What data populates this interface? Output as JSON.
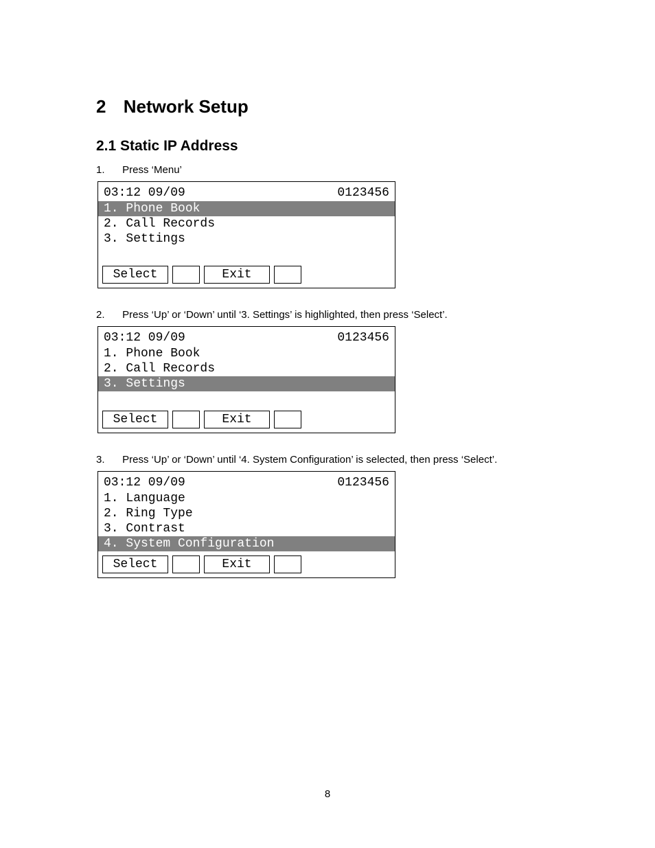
{
  "chapter": {
    "number": "2",
    "title": "Network Setup"
  },
  "section": {
    "number": "2.1",
    "title": "Static IP Address"
  },
  "steps": [
    {
      "n": "1.",
      "text": "Press ‘Menu’"
    },
    {
      "n": "2.",
      "text": "Press ‘Up’ or ‘Down’ until ‘3. Settings’ is highlighted, then press ‘Select’."
    },
    {
      "n": "3.",
      "text": "Press ‘Up’ or ‘Down’ until ‘4. System Configuration’ is selected, then press ‘Select’."
    }
  ],
  "screens": [
    {
      "time": "03:12 09/09",
      "num": "0123456",
      "items": [
        {
          "label": "1. Phone Book",
          "hi": true
        },
        {
          "label": "2. Call Records",
          "hi": false
        },
        {
          "label": "3. Settings",
          "hi": false
        }
      ],
      "spacer": true,
      "softkeys": {
        "left": "Select",
        "right": "Exit"
      }
    },
    {
      "time": "03:12 09/09",
      "num": "0123456",
      "items": [
        {
          "label": "1. Phone Book",
          "hi": false
        },
        {
          "label": "2. Call Records",
          "hi": false
        },
        {
          "label": "3. Settings",
          "hi": true
        }
      ],
      "spacer": true,
      "softkeys": {
        "left": "Select",
        "right": "Exit"
      }
    },
    {
      "time": "03:12 09/09",
      "num": "0123456",
      "items": [
        {
          "label": "1. Language",
          "hi": false
        },
        {
          "label": "2. Ring Type",
          "hi": false
        },
        {
          "label": "3. Contrast",
          "hi": false
        },
        {
          "label": "4. System Configuration",
          "hi": true
        }
      ],
      "spacer": false,
      "softkeys": {
        "left": "Select",
        "right": "Exit"
      }
    }
  ],
  "page_number": "8"
}
